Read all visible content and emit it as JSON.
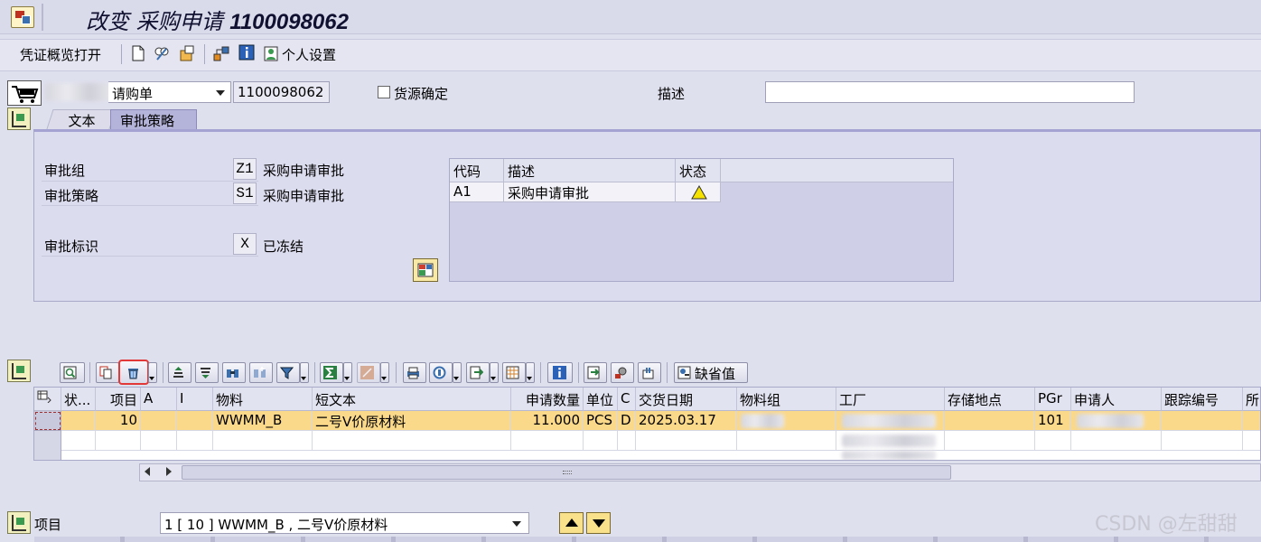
{
  "title": {
    "prefix": "改变 采购申请 ",
    "number": "1100098062"
  },
  "toolbar": {
    "doc_overview_label": "凭证概览打开",
    "personal_settings_label": "个人设置"
  },
  "header": {
    "doc_type": "请购单",
    "doc_number": "1100098062",
    "source_determination_label": "货源确定",
    "description_label": "描述",
    "description_value": ""
  },
  "tabs": [
    {
      "label": "文本",
      "active": false
    },
    {
      "label": "审批策略",
      "active": true
    }
  ],
  "approval": {
    "group_label": "审批组",
    "group_code": "Z1",
    "group_text": "采购申请审批",
    "strategy_label": "审批策略",
    "strategy_code": "S1",
    "strategy_text": "采购申请审批",
    "indicator_label": "审批标识",
    "indicator_code": "X",
    "indicator_text": "已冻结",
    "grid": {
      "headers": [
        "代码",
        "描述",
        "状态"
      ],
      "rows": [
        {
          "code": "A1",
          "desc": "采购申请审批",
          "status_icon": "warning-triangle-icon"
        }
      ]
    }
  },
  "items_toolbar": {
    "default_values_label": "缺省值"
  },
  "items": {
    "headers": [
      "状...",
      "项目",
      "A",
      "I",
      "物料",
      "短文本",
      "申请数量",
      "单位",
      "C",
      "交货日期",
      "物料组",
      "工厂",
      "存储地点",
      "PGr",
      "申请人",
      "跟踪编号",
      "所需"
    ],
    "rows": [
      {
        "status": "",
        "item": "10",
        "a": "",
        "i": "",
        "material": "WWMM_B",
        "short_text": "二号V价原材料",
        "qty": "11.000",
        "unit": "PCS",
        "c": "D",
        "delivery_date": "2025.03.17",
        "mat_group": "",
        "plant": "",
        "storage": "",
        "pgr": "101",
        "requester": "",
        "tracking": ""
      }
    ]
  },
  "footer": {
    "item_label": "项目",
    "item_select": "1 [ 10 ] WWMM_B , 二号V价原材料"
  },
  "watermark": "CSDN @左甜甜",
  "colors": {
    "highlight_row": "#fbd98a",
    "tab_active": "#b4b3da",
    "panel_bg": "#dcdcef"
  }
}
